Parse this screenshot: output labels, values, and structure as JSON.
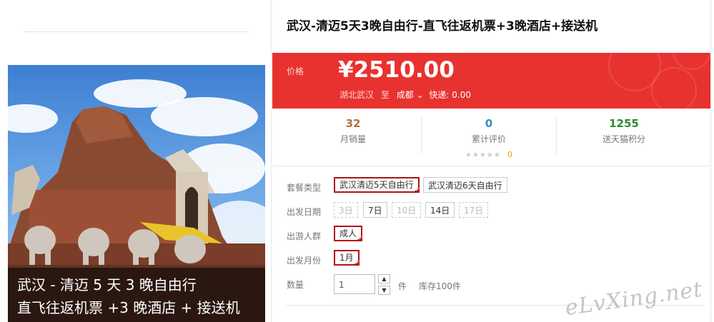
{
  "product": {
    "title": "武汉-清迈5天3晚自由行-直飞往返机票+3晚酒店+接送机",
    "image_caption_line1": "武汉 - 清迈 5 天 3 晚自由行",
    "image_caption_line2": "直飞往返机票 +3 晚酒店 + 接送机"
  },
  "price": {
    "label": "价格",
    "value": "¥2510.00",
    "from": "湖北武汉",
    "to_word": "至",
    "destination": "成都",
    "shipping": "快递: 0.00",
    "colors": {
      "bg": "#e8322f"
    }
  },
  "stats": [
    {
      "value": "32",
      "label": "月销量",
      "color": "#b4703b"
    },
    {
      "value": "0",
      "label": "累计评价",
      "color": "#3a8bbf",
      "stars": "★★★★★",
      "rating": "0"
    },
    {
      "value": "1255",
      "label": "送天猫积分",
      "color": "#2e8b2e"
    }
  ],
  "options": {
    "package": {
      "label": "套餐类型",
      "items": [
        "武汉清迈5天自由行",
        "武汉清迈6天自由行"
      ],
      "selected": "武汉清迈5天自由行"
    },
    "date": {
      "label": "出发日期",
      "items": [
        "3日",
        "7日",
        "10日",
        "14日",
        "17日"
      ],
      "available": [
        "7日",
        "14日"
      ]
    },
    "crowd": {
      "label": "出游人群",
      "items": [
        "成人"
      ],
      "selected": "成人"
    },
    "month": {
      "label": "出发月份",
      "items": [
        "1月"
      ],
      "selected": "1月"
    },
    "quantity": {
      "label": "数量",
      "value": "1",
      "unit": "件",
      "stock": "库存100件"
    }
  },
  "watermark": "eLvXing.net",
  "icons": {
    "up": "chevron-up-icon",
    "down": "chevron-down-icon"
  }
}
